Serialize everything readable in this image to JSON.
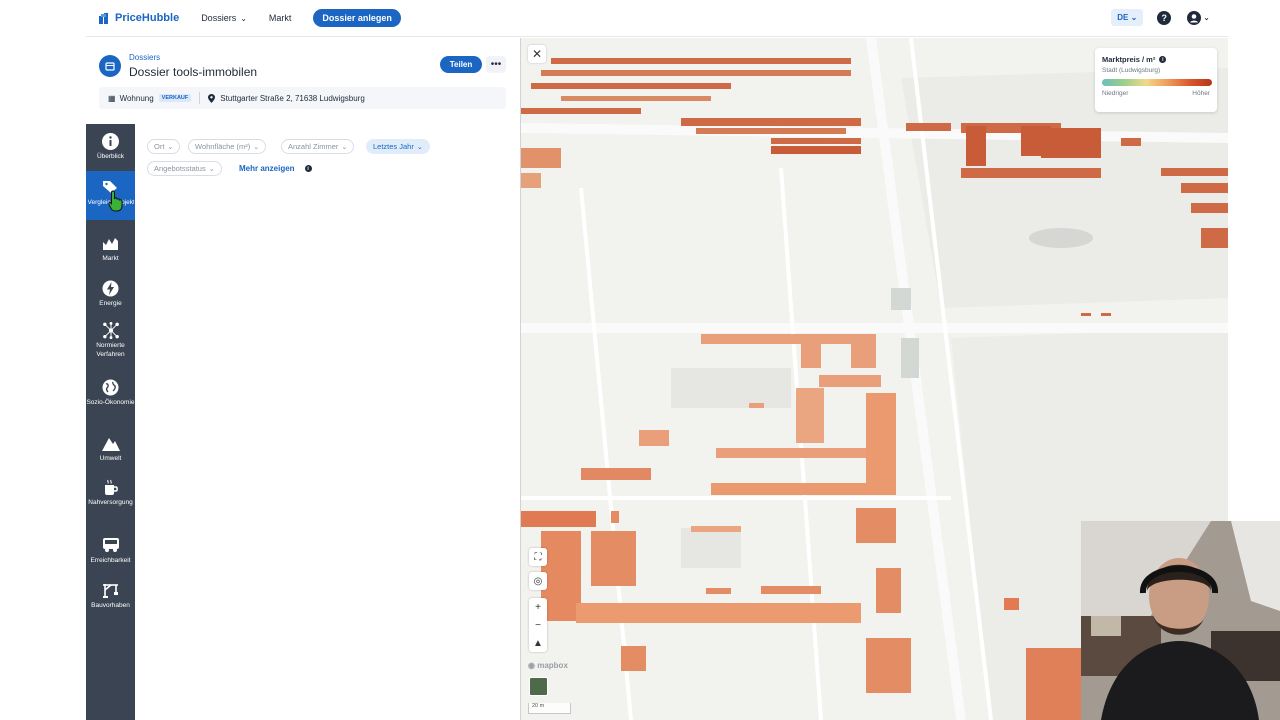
{
  "brand": {
    "name": "PriceHubble"
  },
  "topnav": {
    "dossiers": "Dossiers",
    "market": "Markt",
    "create": "Dossier anlegen",
    "language": "DE"
  },
  "dossier": {
    "breadcrumb": "Dossiers",
    "title": "Dossier tools-immobilen",
    "share": "Teilen",
    "property_type": "Wohnung",
    "deal_badge": "VERKAUF",
    "address": "Stuttgarter Straße 2, 71638 Ludwigsburg"
  },
  "sidebar": {
    "items": [
      {
        "label": "Überblick",
        "icon": "info-icon"
      },
      {
        "label": "Vergleichsobjekte",
        "icon": "tags-icon"
      },
      {
        "label": "Markt",
        "icon": "chart-icon"
      },
      {
        "label": "Energie",
        "icon": "energy-icon"
      },
      {
        "label": "Normierte Verfahren",
        "icon": "network-icon"
      },
      {
        "label": "Sozio-Ökonomie",
        "icon": "globe-icon"
      },
      {
        "label": "Umwelt",
        "icon": "mountain-icon"
      },
      {
        "label": "Nahversorgung",
        "icon": "coffee-icon"
      },
      {
        "label": "Erreichbarkeit",
        "icon": "bus-icon"
      },
      {
        "label": "Bauvorhaben",
        "icon": "crane-icon"
      }
    ]
  },
  "filters": {
    "ort": "Ort",
    "area": "Wohnfläche (m²)",
    "rooms": "Anzahl Zimmer",
    "year": "Letztes Jahr",
    "status": "Angebotsstatus",
    "more": "Mehr anzeigen"
  },
  "legend": {
    "title": "Marktpreis / m²",
    "subtitle": "Stadt (Ludwigsburg)",
    "low": "Niedriger",
    "high": "Höher",
    "colors": [
      "#6bbfbb",
      "#9ccf8b",
      "#f2d98a",
      "#ef9a5a",
      "#d9582c",
      "#b6341b"
    ]
  },
  "map": {
    "attribution": "mapbox",
    "scale": "20 m"
  }
}
